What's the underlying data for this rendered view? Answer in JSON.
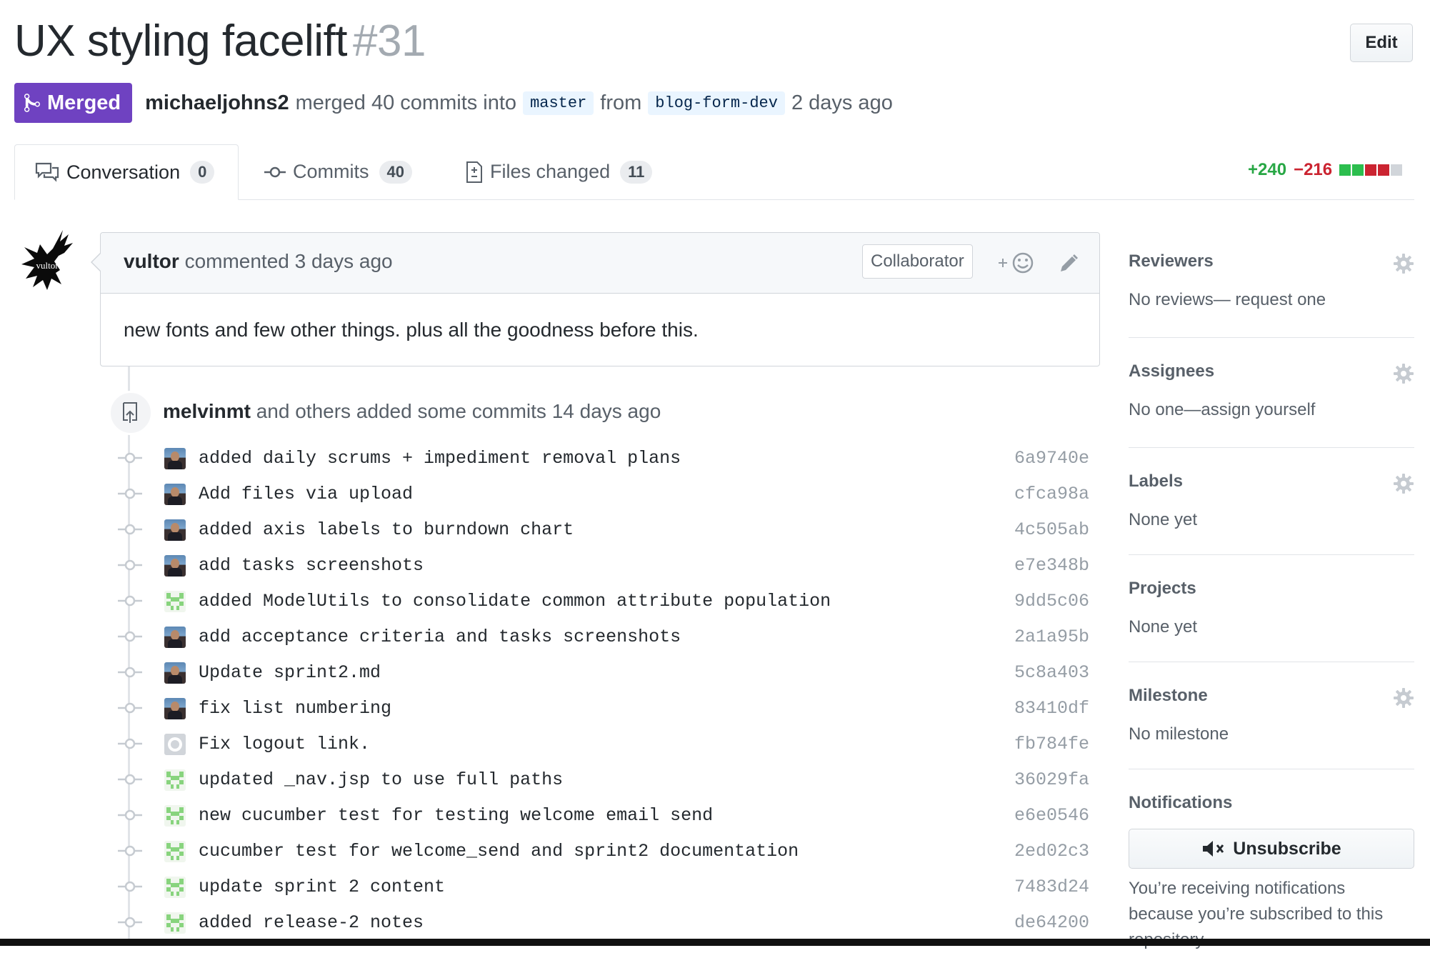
{
  "pr": {
    "title": "UX styling facelift",
    "number": "#31",
    "edit_label": "Edit",
    "state_label": "Merged",
    "author": "michaeljohns2",
    "merged_text": "merged 40 commits into",
    "base_branch": "master",
    "from_text": "from",
    "head_branch": "blog-form-dev",
    "time": "2 days ago"
  },
  "tabs": [
    {
      "label": "Conversation",
      "count": "0",
      "icon": "comment-discussion-icon"
    },
    {
      "label": "Commits",
      "count": "40",
      "icon": "git-commit-icon"
    },
    {
      "label": "Files changed",
      "count": "11",
      "icon": "file-diff-icon"
    }
  ],
  "diffstat": {
    "additions": "+240",
    "deletions": "−216",
    "add_color": "#28a745",
    "del_color": "#cb2431"
  },
  "comment": {
    "author": "vultor",
    "action": "commented 3 days ago",
    "role": "Collaborator",
    "body": "new fonts and few other things. plus all the goodness before this.",
    "avatar_text": "vultor"
  },
  "commit_event": {
    "author": "melvinmt",
    "text": "and others added some commits 14 days ago"
  },
  "commits": [
    {
      "message": "added daily scrums + impediment removal plans",
      "sha": "6a9740e",
      "avatar": "photo"
    },
    {
      "message": "Add files via upload",
      "sha": "cfca98a",
      "avatar": "photo"
    },
    {
      "message": "added axis labels to burndown chart",
      "sha": "4c505ab",
      "avatar": "photo"
    },
    {
      "message": "add tasks screenshots",
      "sha": "e7e348b",
      "avatar": "photo"
    },
    {
      "message": "added ModelUtils to consolidate common attribute population",
      "sha": "9dd5c06",
      "avatar": "identicon"
    },
    {
      "message": "add acceptance criteria and tasks screenshots",
      "sha": "2a1a95b",
      "avatar": "photo"
    },
    {
      "message": "Update sprint2.md",
      "sha": "5c8a403",
      "avatar": "photo"
    },
    {
      "message": "fix list numbering",
      "sha": "83410df",
      "avatar": "photo"
    },
    {
      "message": "Fix logout link.",
      "sha": "fb784fe",
      "avatar": "github"
    },
    {
      "message": "updated _nav.jsp to use full paths",
      "sha": "36029fa",
      "avatar": "identicon"
    },
    {
      "message": "new cucumber test for testing welcome email send",
      "sha": "e6e0546",
      "avatar": "identicon"
    },
    {
      "message": "cucumber test for welcome_send and sprint2 documentation",
      "sha": "2ed02c3",
      "avatar": "identicon"
    },
    {
      "message": "update sprint 2 content",
      "sha": "7483d24",
      "avatar": "identicon"
    },
    {
      "message": "added release-2 notes",
      "sha": "de64200",
      "avatar": "identicon"
    }
  ],
  "sidebar": {
    "reviewers": {
      "heading": "Reviewers",
      "value": "No reviews— request one"
    },
    "assignees": {
      "heading": "Assignees",
      "value": "No one—assign yourself"
    },
    "labels": {
      "heading": "Labels",
      "value": "None yet"
    },
    "projects": {
      "heading": "Projects",
      "value": "None yet"
    },
    "milestone": {
      "heading": "Milestone",
      "value": "No milestone"
    },
    "notifications": {
      "heading": "Notifications",
      "button": "Unsubscribe",
      "text": "You’re receiving notifications because you’re subscribed to this repository."
    }
  },
  "colors": {
    "merged": "#6f42c1",
    "link": "#0366d6",
    "muted": "#586069"
  }
}
